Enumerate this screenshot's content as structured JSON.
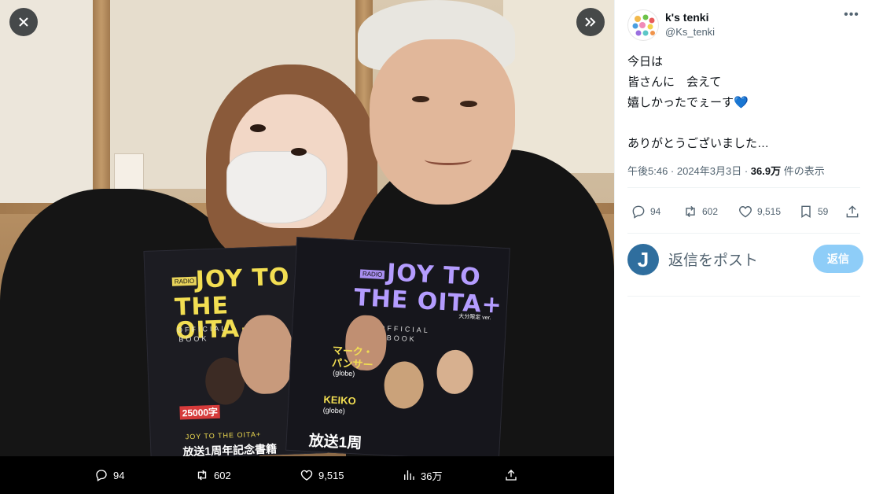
{
  "viewer": {
    "close_icon": "close-icon",
    "next_icon": "chevron-double-right-icon",
    "actions": {
      "replies": "94",
      "reposts": "602",
      "likes": "9,515",
      "views": "36万"
    }
  },
  "photo": {
    "book_left": {
      "badge": "RADIO",
      "title_line1": "JOY TO",
      "title_line2": "THE OITA+",
      "subtitle_line1": "OFFICIAL",
      "subtitle_line2": "BOOK",
      "band_text1": "25000字",
      "band_text2": "JOY TO THE OITA+",
      "band_text3": "放送1周年記念書籍"
    },
    "book_right": {
      "badge": "RADIO",
      "title_line1": "JOY TO",
      "title_line2": "THE OITA+",
      "edition": "大分限定 ver.",
      "subtitle_line1": "OFFICIAL",
      "subtitle_line2": "BOOK",
      "person1_line1": "マーク・",
      "person1_line2": "パンサー",
      "person1_sub": "(globe)",
      "person2": "KEIKO",
      "person2_sub": "(globe)",
      "band_text": "放送1周"
    }
  },
  "tweet": {
    "author_name": "k's tenki",
    "author_handle": "@Ks_tenki",
    "text": "今日は\n皆さんに　会えて\n嬉しかったでぇーす💙\n\nありがとうございました…",
    "time": "午後5:46 · 2024年3月3日 · ",
    "views_count": "36.9万",
    "views_label": " 件の表示",
    "stats": {
      "replies": "94",
      "reposts": "602",
      "likes": "9,515",
      "bookmarks": "59"
    },
    "reply_avatar_letter": "J",
    "reply_placeholder": "返信をポスト",
    "reply_button": "返信"
  },
  "colors": {
    "accent": "#1d9bf0",
    "reply_button": "#8ecdf8",
    "text_primary": "#0f1419",
    "text_secondary": "#536471"
  }
}
